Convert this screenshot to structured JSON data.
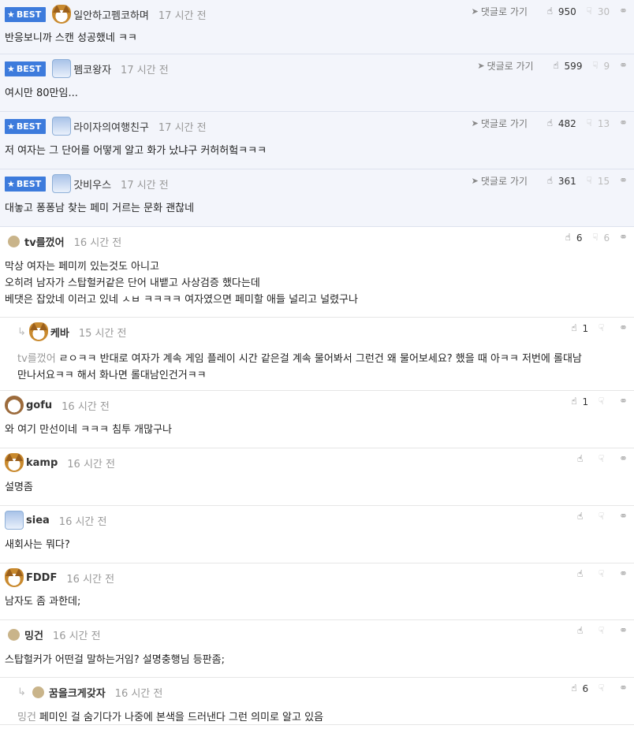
{
  "best_label": "BEST",
  "goto_label": "댓글로 가기",
  "comments": [
    {
      "best": true,
      "avatar": "fox-icon",
      "nick": "일안하고펨코하며",
      "time": "17 시간 전",
      "up": "950",
      "down": "30",
      "text": "반응보니까 스캔 성공했네 ㅋㅋ"
    },
    {
      "best": true,
      "avatar": "robot-icon",
      "nick": "펨코왕자",
      "time": "17 시간 전",
      "up": "599",
      "down": "9",
      "text": "여시만 80만임..."
    },
    {
      "best": true,
      "avatar": "robot-icon",
      "nick": "라이자의여행친구",
      "time": "17 시간 전",
      "up": "482",
      "down": "13",
      "text": "저 여자는 그 단어를 어떻게 알고 화가 났냐구 커허허헠ㅋㅋㅋ"
    },
    {
      "best": true,
      "avatar": "robot-icon",
      "nick": "갓비우스",
      "time": "17 시간 전",
      "up": "361",
      "down": "15",
      "text": "대놓고 퐁퐁남 찾는 페미 거르는 문화 괜찮네"
    },
    {
      "best": false,
      "avatar": "dot-icon",
      "nick": "tv를껐어",
      "time": "16 시간 전",
      "up": "6",
      "down": "6",
      "text": "막상 여자는 페미끼 있는것도 아니고\n오히려 남자가 스탑헐커같은 단어 내뱉고 사상검증 했다는데\n베댓은 잡았네 이러고 있네 ㅅㅂ ㅋㅋㅋㅋ 여자였으면 페미할 애들 널리고 널렸구나"
    },
    {
      "best": false,
      "reply": true,
      "avatar": "fox-icon",
      "nick": "케바",
      "time": "15 시간 전",
      "up": "1",
      "down": "",
      "mention": "tv를껐어",
      "text": "ㄹㅇㅋㅋ 반대로 여자가 계속 게임 플레이 시간 같은걸 계속 물어봐서 그런건 왜 물어보세요? 했을 때 아ㅋㅋ 저번에 롤대남\n만나서요ㅋㅋ 해서 화나면 롤대남인건거ㅋㅋ"
    },
    {
      "best": false,
      "avatar": "dog-icon",
      "nick": "gofu",
      "time": "16 시간 전",
      "up": "1",
      "down": "",
      "text": "와 여기 만선이네 ㅋㅋㅋ 침투 개많구나"
    },
    {
      "best": false,
      "avatar": "fox-icon",
      "nick": "kamp",
      "time": "16 시간 전",
      "up": "",
      "down": "",
      "text": "설명좀"
    },
    {
      "best": false,
      "avatar": "robot-icon",
      "nick": "siea",
      "time": "16 시간 전",
      "up": "",
      "down": "",
      "text": "새회사는 뭐다?"
    },
    {
      "best": false,
      "avatar": "fox-icon",
      "nick": "FDDF",
      "time": "16 시간 전",
      "up": "",
      "down": "",
      "text": "남자도 좀 과한데;"
    },
    {
      "best": false,
      "avatar": "dot-icon",
      "nick": "밍건",
      "time": "16 시간 전",
      "up": "",
      "down": "",
      "text": "스탑헐커가 어떤걸 말하는거임? 설명충행님 등판좀;"
    },
    {
      "best": false,
      "reply": true,
      "avatar": "dot-icon",
      "nick": "꿈을크게갖자",
      "time": "16 시간 전",
      "up": "6",
      "down": "",
      "mention": "밍건",
      "text": "페미인 걸 숨기다가 나중에 본색을 드러낸다 그런 의미로 알고 있음"
    }
  ]
}
